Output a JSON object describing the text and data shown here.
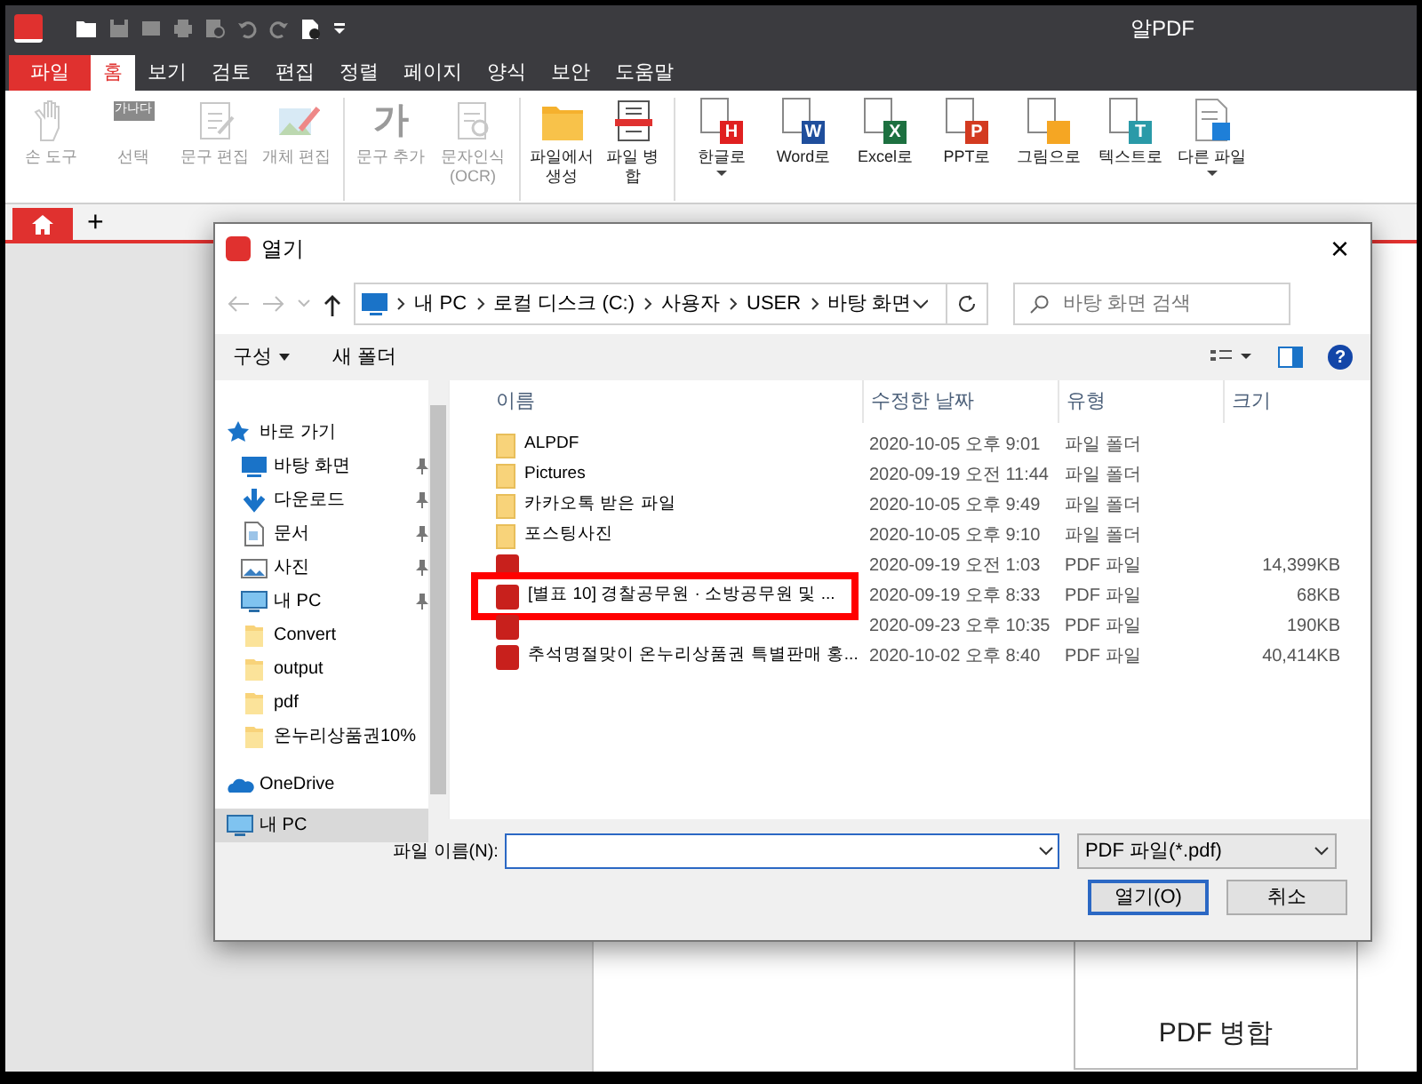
{
  "app": {
    "title": "알PDF"
  },
  "menu_tabs": [
    {
      "label": "파일",
      "kind": "file",
      "selected": false
    },
    {
      "label": "홈",
      "kind": "tab",
      "selected": true
    },
    {
      "label": "보기",
      "kind": "tab",
      "selected": false
    },
    {
      "label": "검토",
      "kind": "tab",
      "selected": false
    },
    {
      "label": "편집",
      "kind": "tab",
      "selected": false
    },
    {
      "label": "정렬",
      "kind": "tab",
      "selected": false
    },
    {
      "label": "페이지",
      "kind": "tab",
      "selected": false
    },
    {
      "label": "양식",
      "kind": "tab",
      "selected": false
    },
    {
      "label": "보안",
      "kind": "tab",
      "selected": false
    },
    {
      "label": "도움말",
      "kind": "tab",
      "selected": false
    }
  ],
  "ribbon_groups": [
    {
      "items": [
        {
          "label": "손 도구",
          "kind": "hand",
          "disabled": true
        },
        {
          "label": "선택",
          "kind": "select",
          "icon_text": "가나다",
          "disabled": true
        },
        {
          "label": "문구 편집",
          "kind": "edit",
          "disabled": true
        },
        {
          "label": "개체 편집",
          "kind": "image-edit",
          "disabled": true
        }
      ]
    },
    {
      "items": [
        {
          "label": "문구 추가",
          "kind": "glyph",
          "icon_text": "가",
          "disabled": true
        },
        {
          "label": "문자인식 (OCR)",
          "kind": "ocr",
          "disabled": true
        }
      ]
    },
    {
      "items": [
        {
          "label": "파일에서 생성",
          "kind": "folder",
          "disabled": false
        },
        {
          "label": "파일 병합",
          "kind": "merge",
          "disabled": false
        }
      ]
    },
    {
      "items": [
        {
          "label": "한글로",
          "kind": "convert",
          "icon_text": "H",
          "color": "#e02020",
          "dropdown": true,
          "disabled": false
        },
        {
          "label": "Word로",
          "kind": "convert",
          "icon_text": "W",
          "color": "#1f4e9c",
          "disabled": false
        },
        {
          "label": "Excel로",
          "kind": "convert",
          "icon_text": "X",
          "color": "#1d7040",
          "disabled": false
        },
        {
          "label": "PPT로",
          "kind": "convert",
          "icon_text": "P",
          "color": "#d33a20",
          "disabled": false
        },
        {
          "label": "그림으로",
          "kind": "convert",
          "color": "#f5a623",
          "disabled": false
        },
        {
          "label": "텍스트로",
          "kind": "convert",
          "icon_text": "T",
          "color": "#2a9aa8",
          "disabled": false
        },
        {
          "label": "다른 파일",
          "kind": "other",
          "dropdown": true,
          "disabled": false
        }
      ]
    }
  ],
  "doc_tabs": {
    "add": "+"
  },
  "background_card": {
    "label": "PDF 병합"
  },
  "dialog": {
    "title": "열기",
    "close": "×",
    "path": [
      "내 PC",
      "로컬 디스크 (C:)",
      "사용자",
      "USER",
      "바탕 화면"
    ],
    "search": {
      "placeholder": "바탕 화면 검색"
    },
    "toolbar": {
      "organize": "구성",
      "new_folder": "새 폴더"
    },
    "sidebar": [
      {
        "label": "바로 가기",
        "kind": "star",
        "pinned": false,
        "selected": false
      },
      {
        "label": "바탕 화면",
        "kind": "desktop",
        "pinned": true,
        "selected": false
      },
      {
        "label": "다운로드",
        "kind": "download",
        "pinned": true,
        "selected": false
      },
      {
        "label": "문서",
        "kind": "document",
        "pinned": true,
        "selected": false
      },
      {
        "label": "사진",
        "kind": "picture",
        "pinned": true,
        "selected": false
      },
      {
        "label": "내 PC",
        "kind": "pc",
        "pinned": true,
        "selected": false
      },
      {
        "label": "Convert",
        "kind": "folder",
        "pinned": false,
        "selected": false
      },
      {
        "label": "output",
        "kind": "folder",
        "pinned": false,
        "selected": false
      },
      {
        "label": "pdf",
        "kind": "folder",
        "pinned": false,
        "selected": false
      },
      {
        "label": "온누리상품권10%",
        "kind": "folder",
        "pinned": false,
        "selected": false
      },
      {
        "label": "OneDrive",
        "kind": "cloud",
        "pinned": false,
        "selected": false
      },
      {
        "label": "내 PC",
        "kind": "pc",
        "pinned": false,
        "selected": true
      }
    ],
    "columns": [
      "이름",
      "수정한 날짜",
      "유형",
      "크기"
    ],
    "files": [
      {
        "name": "ALPDF",
        "kind": "folder",
        "date": "2020-10-05 오후 9:01",
        "type": "파일 폴더",
        "highlighted": false
      },
      {
        "name": "Pictures",
        "kind": "folder",
        "date": "2020-09-19 오전 11:44",
        "type": "파일 폴더",
        "highlighted": false
      },
      {
        "name": "카카오톡 받은 파일",
        "kind": "folder",
        "date": "2020-10-05 오후 9:49",
        "type": "파일 폴더",
        "highlighted": false
      },
      {
        "name": "포스팅사진",
        "kind": "folder",
        "date": "2020-10-05 오후 9:10",
        "type": "파일 폴더",
        "highlighted": false
      },
      {
        "kind": "pdf",
        "date": "2020-09-19 오전 1:03",
        "type": "PDF 파일",
        "size": "14,399KB",
        "highlighted": false
      },
      {
        "name": "[별표 10] 경찰공무원 · 소방공무원 및 ...",
        "kind": "pdf",
        "date": "2020-09-19 오후 8:33",
        "type": "PDF 파일",
        "size": "68KB",
        "highlighted": true
      },
      {
        "kind": "pdf",
        "date": "2020-09-23 오후 10:35",
        "type": "PDF 파일",
        "size": "190KB",
        "highlighted": false
      },
      {
        "name": "추석명절맞이 온누리상품권 특별판매 홍...",
        "kind": "pdf",
        "date": "2020-10-02 오후 8:40",
        "type": "PDF 파일",
        "size": "40,414KB",
        "highlighted": false
      }
    ],
    "filename": {
      "label": "파일 이름(N):"
    },
    "help": "?",
    "filter": "PDF 파일(*.pdf)",
    "buttons": [
      {
        "label": "열기(O)",
        "default": true
      },
      {
        "label": "취소",
        "default": false
      }
    ]
  }
}
